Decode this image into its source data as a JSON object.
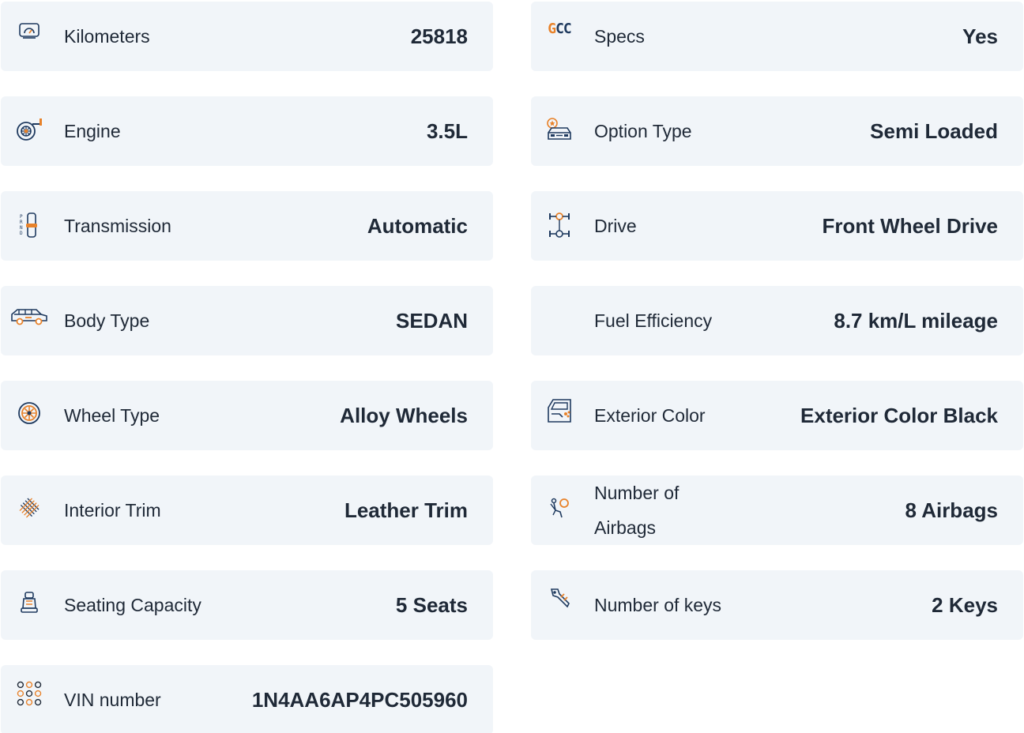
{
  "colors": {
    "card_bg": "#f1f5f9",
    "accent": "#e8822a",
    "icon_dark": "#1f3a5f",
    "text": "#1f2937"
  },
  "left": [
    {
      "label": "Kilometers",
      "value": "25818",
      "icon": "speedometer-icon"
    },
    {
      "label": "Engine",
      "value": "3.5L",
      "icon": "turbo-engine-icon"
    },
    {
      "label": "Transmission",
      "value": "Automatic",
      "icon": "gear-shifter-icon"
    },
    {
      "label": "Body Type",
      "value": "SEDAN",
      "icon": "car-body-icon"
    },
    {
      "label": "Wheel Type",
      "value": "Alloy Wheels",
      "icon": "alloy-wheel-icon"
    },
    {
      "label": "Interior Trim",
      "value": "Leather Trim",
      "icon": "leather-pattern-icon"
    },
    {
      "label": "Seating Capacity",
      "value": "5 Seats",
      "icon": "car-seat-icon"
    },
    {
      "label": "VIN number",
      "value": "1N4AA6AP4PC505960",
      "icon": "dots-grid-icon"
    }
  ],
  "right": [
    {
      "label": "Specs",
      "value": "Yes",
      "icon": "gcc-icon",
      "icon_text_g": "G",
      "icon_text_cc": "CC"
    },
    {
      "label": "Option Type",
      "value": "Semi Loaded",
      "icon": "car-star-icon"
    },
    {
      "label": "Drive",
      "value": "Front Wheel Drive",
      "icon": "drivetrain-icon"
    },
    {
      "label": "Fuel Efficiency",
      "value": "8.7 km/L mileage",
      "icon": ""
    },
    {
      "label": "Exterior Color",
      "value": "Exterior Color Black",
      "icon": "paint-door-icon"
    },
    {
      "label": "Number of Airbags",
      "value": "8 Airbags",
      "icon": "airbag-icon"
    },
    {
      "label": "Number of keys",
      "value": "2 Keys",
      "icon": "car-key-icon"
    }
  ]
}
